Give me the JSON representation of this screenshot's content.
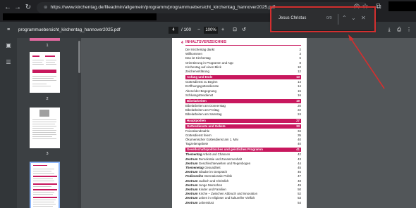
{
  "browser": {
    "url": "https://www.kirchentag.de/fileadmin/allgemein/programm/programmuebersicht_kirchentag_hannover2025.pdf"
  },
  "pdf_toolbar": {
    "file_name": "programmuebersicht_kirchentag_hannover2025.pdf",
    "current_page": "4",
    "total_pages": "/ 100",
    "zoom": "100%"
  },
  "find": {
    "query": "Jesus Christus",
    "count": "0/0"
  },
  "thumbnails": {
    "labels": [
      "1",
      "2",
      "3",
      "4"
    ]
  },
  "page": {
    "number": "4",
    "title": "INHALTSVERZEICHNIS",
    "rows": [
      {
        "label": "Der Kirchentag dankt",
        "num": "2",
        "type": "plain"
      },
      {
        "label": "Willkommen",
        "num": "3",
        "type": "plain"
      },
      {
        "label": "Das ist Kirchentag",
        "num": "6",
        "type": "plain"
      },
      {
        "label": "Orientierung in Programm und App",
        "num": "8",
        "type": "plain"
      },
      {
        "label": "Kirchentag auf einen Blick",
        "num": "10",
        "type": "plain"
      },
      {
        "label": "Zeichenerklärung",
        "num": "12",
        "type": "plain"
      },
      {
        "label": "Anfang und Ende",
        "num": "13",
        "type": "sec"
      },
      {
        "label": "Gottesdienst zu Beginn",
        "num": "14",
        "type": "plain"
      },
      {
        "label": "Eröffnungsgottesdienste",
        "num": "14",
        "type": "plain"
      },
      {
        "label": "Abend der Begegnung",
        "num": "15",
        "type": "plain"
      },
      {
        "label": "Schlussgottesdienst",
        "num": "16",
        "type": "plain"
      },
      {
        "label": "Bibelarbeiten",
        "num": "19",
        "type": "sec"
      },
      {
        "label": "Bibelarbeiten am Donnerstag",
        "num": "20",
        "type": "plain"
      },
      {
        "label": "Bibelarbeiten am Freitag",
        "num": "22",
        "type": "plain"
      },
      {
        "label": "Bibelarbeiten am Samstag",
        "num": "24",
        "type": "plain"
      },
      {
        "label": "Hauptpodien",
        "num": "27",
        "type": "sec"
      },
      {
        "label": "Gottesdienste und Gebete",
        "num": "33",
        "type": "sec"
      },
      {
        "label": "Feierabendmahle",
        "num": "34",
        "type": "plain"
      },
      {
        "label": "Gottesdienst feiern",
        "num": "35",
        "type": "plain"
      },
      {
        "label": "Ökumenischer Gottesdienst am 1. Mai",
        "num": "40",
        "type": "plain"
      },
      {
        "label": "Tagzeitengebete",
        "num": "40",
        "type": "plain"
      },
      {
        "label": "Gesellschaftspolitisches und geistliches Programm",
        "num": "41",
        "type": "sec"
      },
      {
        "bold": "Thementag",
        "label": " Arbeit und Chancen",
        "num": "42",
        "type": "em"
      },
      {
        "bold": "Zentrum",
        "label": " Demokratie und Zusammenhalt",
        "num": "43",
        "type": "em"
      },
      {
        "bold": "Zentrum",
        "label": " Geschlechterwelten und Regenbogen",
        "num": "44",
        "type": "em"
      },
      {
        "bold": "Themenetag",
        "label": " Gesundheit",
        "num": "45",
        "type": "em"
      },
      {
        "bold": "Zentrum",
        "label": " Glaube im Gespräch",
        "num": "46",
        "type": "em"
      },
      {
        "bold": "Podienreihe",
        "label": " Internationale Politik",
        "num": "47",
        "type": "em"
      },
      {
        "bold": "Zentrum",
        "label": " Judisch und Christlich",
        "num": "48",
        "type": "em"
      },
      {
        "bold": "Zentrum",
        "label": " Junge Menschen",
        "num": "49",
        "type": "em"
      },
      {
        "bold": "Zentrum",
        "label": " Kinder und Familien",
        "num": "50",
        "type": "em"
      },
      {
        "bold": "Zentrum",
        "label": " Kirche – Zwischen Abbruch und Innovation",
        "num": "52",
        "type": "em"
      },
      {
        "bold": "Zentrum",
        "label": " Leben in religiöser und kultureller Vielfalt",
        "num": "53",
        "type": "em"
      },
      {
        "bold": "Zentrum",
        "label": " Lebenslust",
        "num": "54",
        "type": "em"
      }
    ]
  }
}
